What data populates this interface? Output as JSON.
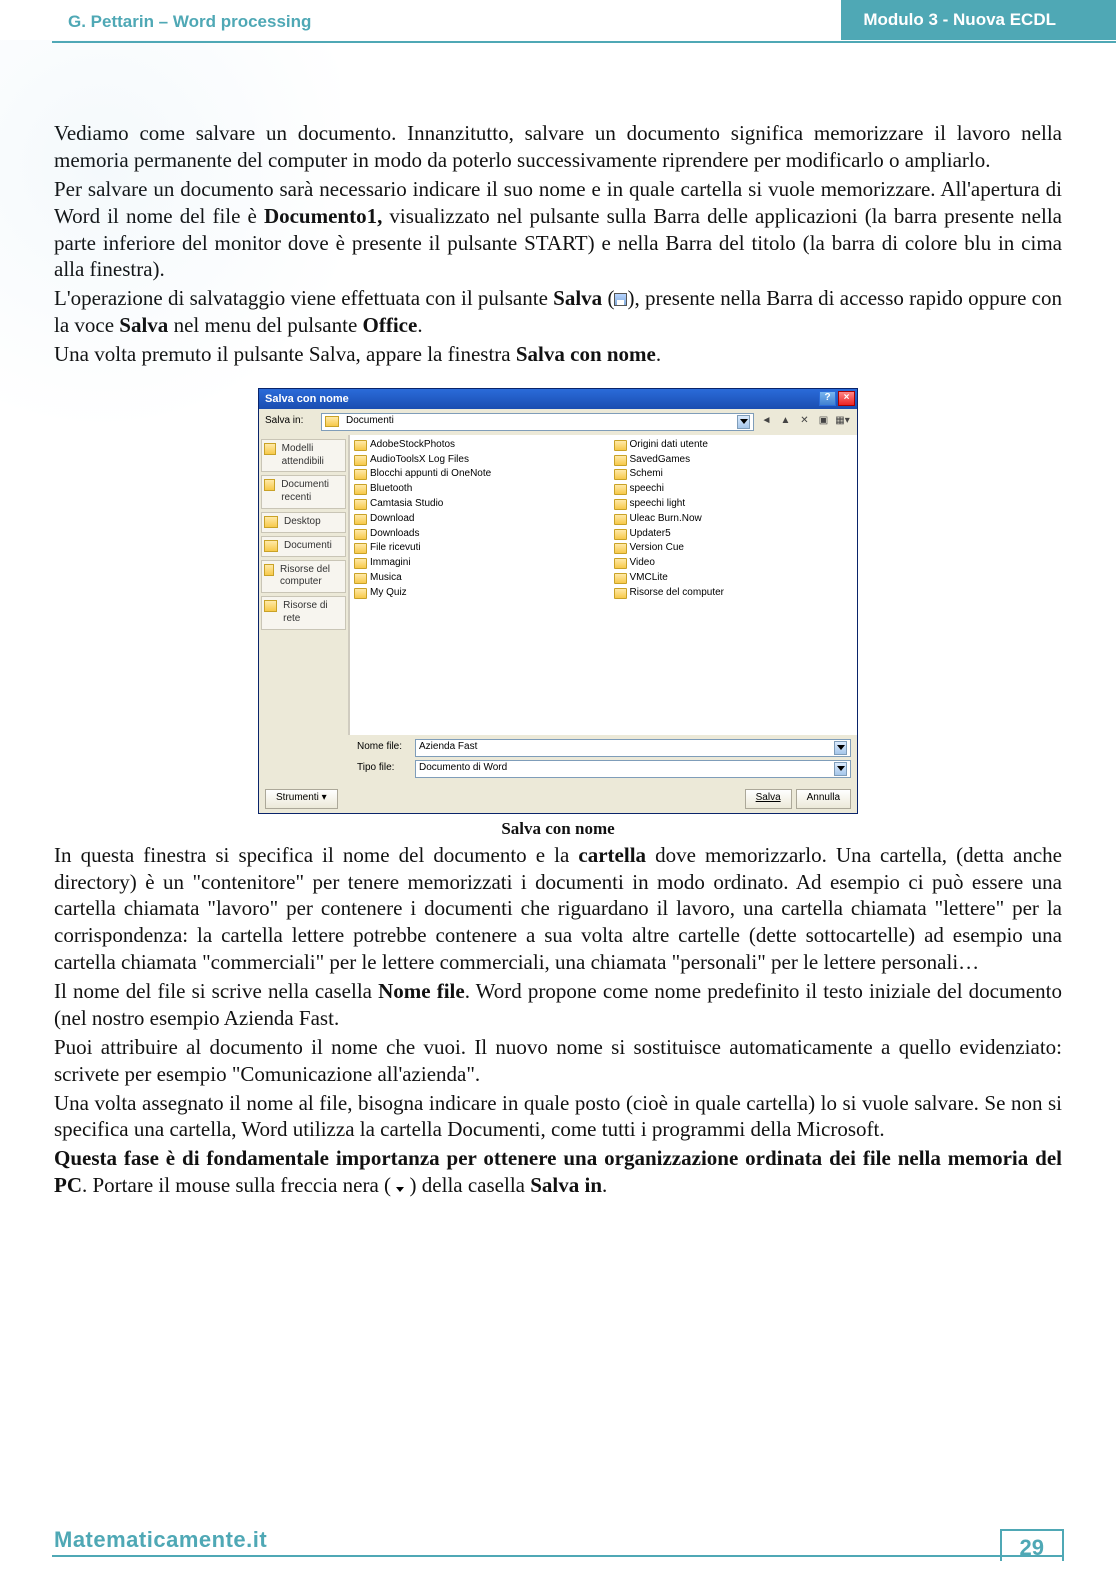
{
  "header": {
    "left": "G. Pettarin – Word processing",
    "right": "Modulo 3 - Nuova ECDL"
  },
  "para": {
    "p1a": "Vediamo come salvare un documento. Innanzitutto, salvare un documento significa memorizzare il lavoro nella memoria permanente del computer in modo da poterlo successivamente riprendere per modificarlo o ampliarlo.",
    "p1b_a": "Per salvare un documento sarà necessario indicare il suo nome e in quale cartella si vuole memorizzare. All'apertura di Word il nome del file è ",
    "p1b_b": "Documento1,",
    "p1b_c": " visualizzato nel pulsante sulla Barra delle applicazioni (la barra presente nella parte inferiore del monitor dove è presente il pulsante START) e nella Barra del titolo (la barra di colore blu in cima alla finestra).",
    "p1c_a": "L'operazione di salvataggio viene effettuata con il pulsante ",
    "p1c_b": "Salva",
    "p1c_c": " (",
    "p1c_d": "), presente nella Barra di accesso rapido oppure con la voce ",
    "p1c_e": "Salva",
    "p1c_f": " nel menu del pulsante ",
    "p1c_g": "Office",
    "p1c_h": ".",
    "p1d_a": "Una volta premuto il pulsante Salva, appare la finestra ",
    "p1d_b": "Salva con nome",
    "p1d_c": "."
  },
  "caption": "Salva con nome",
  "dialog": {
    "title": "Salva con nome",
    "save_in_lbl": "Salva in:",
    "save_in_value": "Documenti",
    "places": [
      "Modelli attendibili",
      "Documenti recenti",
      "Desktop",
      "Documenti",
      "Risorse del computer",
      "Risorse di rete"
    ],
    "files_col1": [
      "AdobeStockPhotos",
      "AudioToolsX Log Files",
      "Blocchi appunti di OneNote",
      "Bluetooth",
      "Camtasia Studio",
      "Download",
      "Downloads",
      "File ricevuti",
      "Immagini",
      "Musica",
      "My Quiz",
      "Origini dati utente",
      "SavedGames",
      "Schemi",
      "speechi",
      "speechi light",
      "Uleac Burn.Now",
      "Updater5",
      "Version Cue"
    ],
    "files_col2": [
      "Video",
      "VMCLite",
      "Risorse del computer"
    ],
    "name_lbl": "Nome file:",
    "name_value": "Azienda Fast",
    "type_lbl": "Tipo file:",
    "type_value": "Documento di Word",
    "tools": "Strumenti",
    "save": "Salva",
    "cancel": "Annulla"
  },
  "para2": {
    "p2a_a": "In questa finestra si specifica il nome del documento e la ",
    "p2a_b": "cartella",
    "p2a_c": " dove memorizzarlo. Una cartella, (detta anche directory) è un \"contenitore\" per tenere memorizzati i documenti in modo ordinato. Ad esempio ci può essere una cartella chiamata \"lavoro\" per contenere i documenti che riguardano il lavoro, una cartella chiamata \"lettere\" per la corrispondenza: la cartella lettere potrebbe contenere a sua volta altre cartelle (dette sottocartelle) ad esempio una cartella chiamata \"commerciali\" per le lettere commerciali, una chiamata \"personali\" per le lettere personali…",
    "p2b_a": "Il nome del file si scrive nella casella ",
    "p2b_b": "Nome file",
    "p2b_c": ". Word propone come nome predefinito il testo iniziale del documento (nel nostro esempio Azienda Fast.",
    "p2c": "Puoi attribuire al documento il nome che vuoi. Il nuovo nome si sostituisce automaticamente a quello evidenziato: scrivete per esempio \"Comunicazione all'azienda\".",
    "p2d": "Una volta assegnato il nome al file, bisogna indicare in quale posto (cioè in quale cartella) lo si vuole salvare. Se non si specifica una cartella, Word utilizza la cartella Documenti, come tutti i programmi della Microsoft.",
    "p2e_a": "Questa fase è di fondamentale importanza per ottenere una organizzazione ordinata dei file nella memoria del PC",
    "p2e_b": ". Portare il mouse sulla freccia nera ( ",
    "p2e_c": " ) della casella ",
    "p2e_d": "Salva in",
    "p2e_e": "."
  },
  "footer": {
    "site": "Matematicamente.it",
    "page": "29"
  }
}
